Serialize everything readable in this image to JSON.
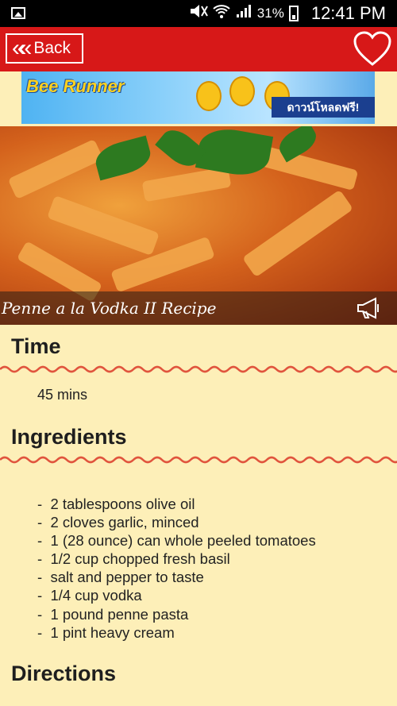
{
  "status_bar": {
    "battery": "31%",
    "time": "12:41 PM"
  },
  "app_bar": {
    "back_label": "Back"
  },
  "ad": {
    "logo": "Bee Runner",
    "cta": "ดาวน์โหลดฟรี!"
  },
  "recipe": {
    "title": "Penne a la Vodka II Recipe",
    "time_heading": "Time",
    "time_value": "45 mins",
    "ingredients_heading": "Ingredients",
    "ingredients": [
      "2 tablespoons olive oil",
      "2 cloves garlic, minced",
      "1 (28 ounce) can whole peeled tomatoes",
      "1/2 cup chopped fresh basil",
      "salt and pepper to taste",
      "1/4 cup vodka",
      "1 pound penne pasta",
      "1 pint heavy cream"
    ],
    "directions_heading": "Directions"
  },
  "colors": {
    "app_bar": "#d71818",
    "background": "#fdefb8",
    "wave": "#e0543d"
  }
}
